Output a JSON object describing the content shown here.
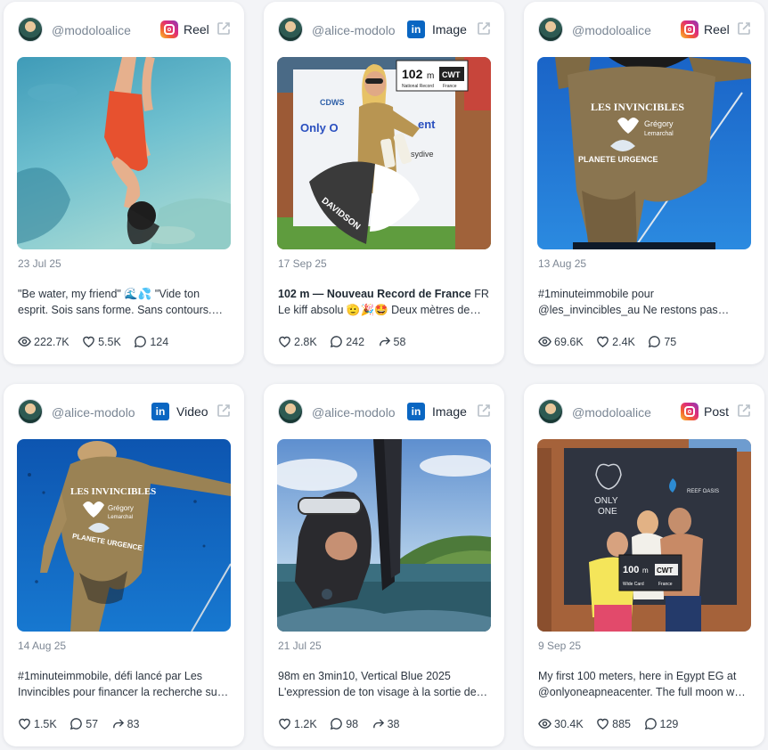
{
  "posts": [
    {
      "handle": "@modoloalice",
      "platform": "instagram",
      "type": "Reel",
      "date": "23 Jul 25",
      "text": "\"Be water, my friend\" 🌊💦 \"Vide ton esprit. Sois sans forme. Sans contours. Comme l'eau.",
      "stats": [
        {
          "icon": "views-icon",
          "value": "222.7K"
        },
        {
          "icon": "likes-icon",
          "value": "5.5K"
        },
        {
          "icon": "comments-icon",
          "value": "124"
        }
      ]
    },
    {
      "handle": "@alice-modolo",
      "platform": "linkedin",
      "type": "Image",
      "date": "17 Sep 25",
      "text_bold": "102 m — Nouveau Record de France",
      "text_rest": " FR Le kiff absolu 🫡🎉🤩 Deux mètres de plus et un nouveau record.",
      "stats": [
        {
          "icon": "likes-icon",
          "value": "2.8K"
        },
        {
          "icon": "comments-icon",
          "value": "242"
        },
        {
          "icon": "shares-icon",
          "value": "58"
        }
      ]
    },
    {
      "handle": "@modoloalice",
      "platform": "instagram",
      "type": "Reel",
      "date": "13 Aug 25",
      "text": "#1minuteimmobile pour @les_invincibles_au Ne restons pas immobiles face à la maladie.",
      "stats": [
        {
          "icon": "views-icon",
          "value": "69.6K"
        },
        {
          "icon": "likes-icon",
          "value": "2.4K"
        },
        {
          "icon": "comments-icon",
          "value": "75"
        }
      ]
    },
    {
      "handle": "@alice-modolo",
      "platform": "linkedin",
      "type": "Video",
      "date": "14 Aug 25",
      "text": "#1minuteimmobile, défi lancé par Les Invincibles pour financer la recherche sur la maladie.",
      "stats": [
        {
          "icon": "likes-icon",
          "value": "1.5K"
        },
        {
          "icon": "comments-icon",
          "value": "57"
        },
        {
          "icon": "shares-icon",
          "value": "83"
        }
      ]
    },
    {
      "handle": "@alice-modolo",
      "platform": "linkedin",
      "type": "Image",
      "date": "21 Jul 25",
      "text": "98m en 3min10, Vertical Blue 2025 L'expression de ton visage à la sortie de l'eau.",
      "stats": [
        {
          "icon": "likes-icon",
          "value": "1.2K"
        },
        {
          "icon": "comments-icon",
          "value": "98"
        },
        {
          "icon": "shares-icon",
          "value": "38"
        }
      ]
    },
    {
      "handle": "@modoloalice",
      "platform": "instagram",
      "type": "Post",
      "date": "9 Sep 25",
      "text": "My first 100 meters, here in Egypt EG at @onlyoneapneacenter. The full moon was shining.",
      "stats": [
        {
          "icon": "views-icon",
          "value": "30.4K"
        },
        {
          "icon": "likes-icon",
          "value": "885"
        },
        {
          "icon": "comments-icon",
          "value": "129"
        }
      ]
    }
  ],
  "images": [
    {
      "sign_number": "102",
      "sign_unit": "m",
      "sign_discipline": "CWT",
      "sign_sub": "National Record",
      "sign_country": "France",
      "banner_brand": "DAVIDSON",
      "banner_text": "Only O",
      "banner_text_2": "ent",
      "banner_text_3": "sydive",
      "banner_logo": "CDWS"
    },
    {
      "suit_text_1": "LES INVINCIBLES",
      "suit_text_2": "Grégory",
      "suit_text_3": "Lemarchal",
      "suit_text_4": "PLANETE URGENCE"
    },
    {
      "suit_text_1": "LES INVINCIBLES",
      "suit_text_2": "Grégory",
      "suit_text_3": "Lemarchal",
      "suit_text_4": "PLANETE URGENCE"
    },
    {
      "sign_number": "100",
      "sign_unit": "m",
      "sign_discipline": "CWT",
      "sign_sub": "Wide Card",
      "sign_country": "France",
      "backdrop_1": "ONLY",
      "backdrop_2": "ONE",
      "backdrop_3": "REEF OASIS"
    }
  ],
  "colors": {
    "instagram": "#e02c78",
    "linkedin": "#0a66c2",
    "text": "#2c3540",
    "muted": "#7d8794"
  }
}
